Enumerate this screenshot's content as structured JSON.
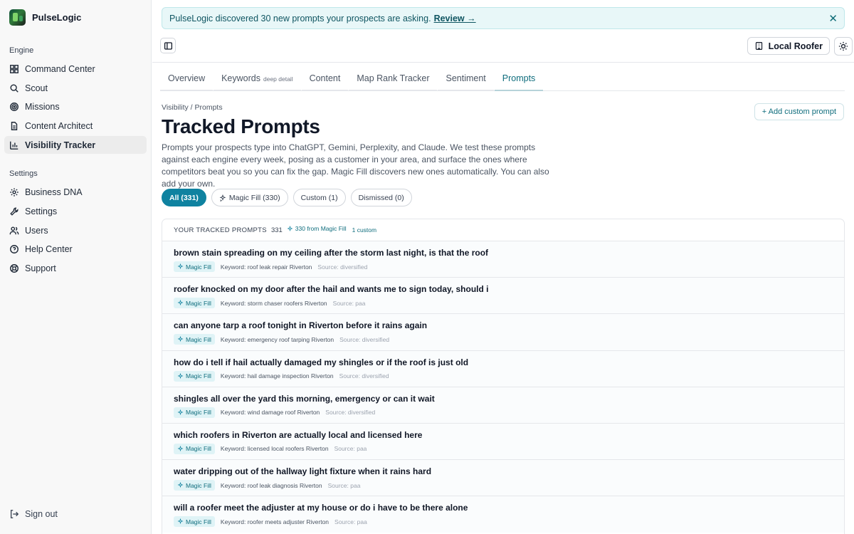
{
  "app": {
    "name": "PulseLogic"
  },
  "sidebar": {
    "engine_label": "Engine",
    "engine_items": [
      {
        "label": "Command Center",
        "icon": "grid-icon"
      },
      {
        "label": "Scout",
        "icon": "search-icon"
      },
      {
        "label": "Missions",
        "icon": "target-icon"
      },
      {
        "label": "Content Architect",
        "icon": "document-icon"
      },
      {
        "label": "Visibility Tracker",
        "icon": "bar-chart-icon",
        "active": true
      }
    ],
    "settings_label": "Settings",
    "settings_items": [
      {
        "label": "Business DNA",
        "icon": "gear-icon"
      },
      {
        "label": "Settings",
        "icon": "wrench-icon"
      },
      {
        "label": "Users",
        "icon": "users-icon"
      },
      {
        "label": "Help Center",
        "icon": "help-icon"
      },
      {
        "label": "Support",
        "icon": "lifebuoy-icon"
      }
    ],
    "signout_label": "Sign out"
  },
  "banner": {
    "text": "PulseLogic discovered 30 new prompts your prospects are asking.",
    "link": "Review →",
    "close": "✕"
  },
  "topbar": {
    "org_name": "Local Roofer"
  },
  "tabs": [
    {
      "label": "Overview",
      "sub": ""
    },
    {
      "label": "Keywords",
      "sub": "deep detail"
    },
    {
      "label": "Content",
      "sub": ""
    },
    {
      "label": "Map Rank Tracker",
      "sub": ""
    },
    {
      "label": "Sentiment",
      "sub": ""
    },
    {
      "label": "Prompts",
      "sub": "",
      "active": true
    }
  ],
  "page": {
    "breadcrumb": "Visibility / Prompts",
    "title": "Tracked Prompts",
    "description": "Prompts your prospects type into ChatGPT, Gemini, Perplexity, and Claude. We test these prompts against each engine every week, posing as a customer in your area, and surface the ones where competitors beat you so you can fix the gap. Magic Fill discovers new ones automatically. You can also add your own.",
    "add_button": "+ Add custom prompt"
  },
  "filters": [
    {
      "label": "All (331)",
      "active": true,
      "icon": ""
    },
    {
      "label": "Magic Fill (330)",
      "active": false,
      "icon": "sparkle-icon"
    },
    {
      "label": "Custom (1)",
      "active": false,
      "icon": ""
    },
    {
      "label": "Dismissed (0)",
      "active": false,
      "icon": ""
    }
  ],
  "list": {
    "header_title": "YOUR TRACKED PROMPTS",
    "header_count": "331",
    "header_magic": "330 from Magic Fill",
    "header_custom": "1 custom",
    "badge_label": "Magic Fill",
    "rows": [
      {
        "title": "brown stain spreading on my ceiling after the storm last night, is that the roof",
        "keyword": "Keyword: roof leak repair Riverton",
        "source": "Source: diversified"
      },
      {
        "title": "roofer knocked on my door after the hail and wants me to sign today, should i",
        "keyword": "Keyword: storm chaser roofers Riverton",
        "source": "Source: paa"
      },
      {
        "title": "can anyone tarp a roof tonight in Riverton before it rains again",
        "keyword": "Keyword: emergency roof tarping Riverton",
        "source": "Source: diversified"
      },
      {
        "title": "how do i tell if hail actually damaged my shingles or if the roof is just old",
        "keyword": "Keyword: hail damage inspection Riverton",
        "source": "Source: diversified"
      },
      {
        "title": "shingles all over the yard this morning, emergency or can it wait",
        "keyword": "Keyword: wind damage roof Riverton",
        "source": "Source: diversified"
      },
      {
        "title": "which roofers in Riverton are actually local and licensed here",
        "keyword": "Keyword: licensed local roofers Riverton",
        "source": "Source: paa"
      },
      {
        "title": "water dripping out of the hallway light fixture when it rains hard",
        "keyword": "Keyword: roof leak diagnosis Riverton",
        "source": "Source: paa"
      },
      {
        "title": "will a roofer meet the adjuster at my house or do i have to be there alone",
        "keyword": "Keyword: roofer meets adjuster Riverton",
        "source": "Source: paa"
      }
    ]
  }
}
